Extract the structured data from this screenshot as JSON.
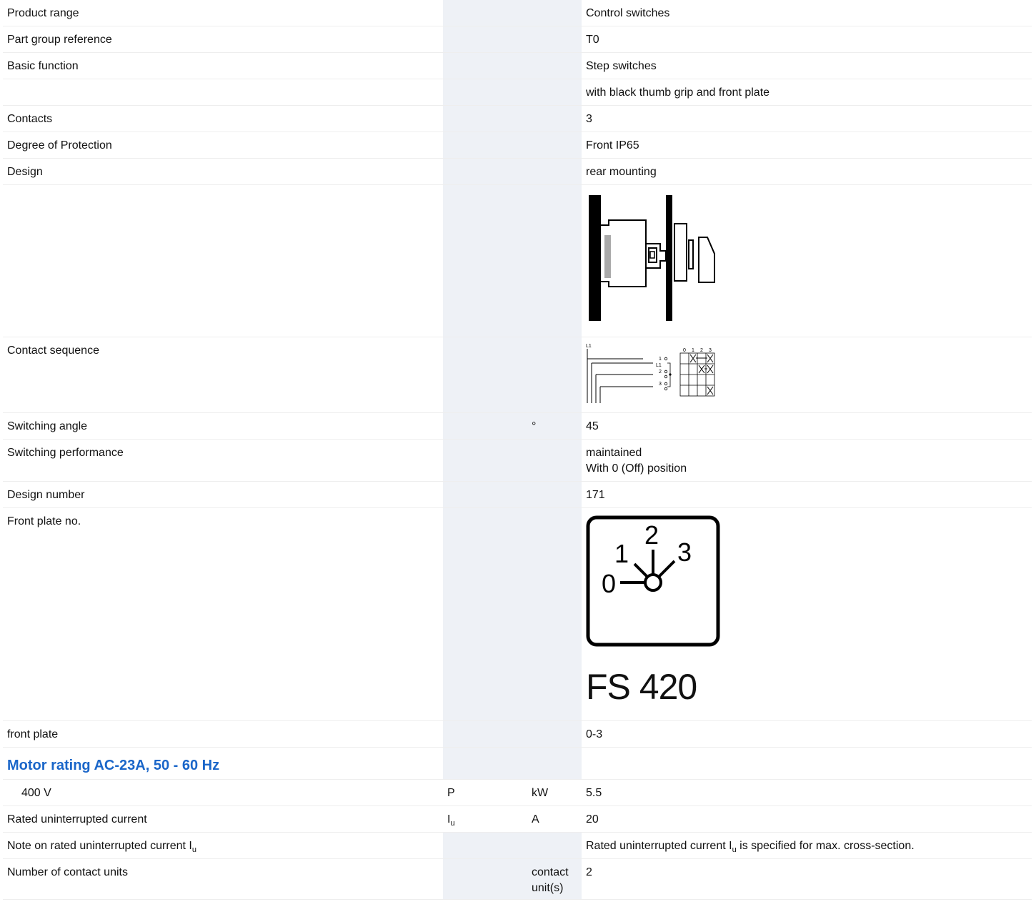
{
  "rows": [
    {
      "label": "Product range",
      "value": "Control switches"
    },
    {
      "label": "Part group reference",
      "value": "T0"
    },
    {
      "label": "Basic function",
      "value": "Step switches"
    },
    {
      "label": "",
      "value": "with black thumb grip and front plate"
    },
    {
      "label": "Contacts",
      "value": "3"
    },
    {
      "label": "Degree of Protection",
      "value": "Front IP65"
    },
    {
      "label": "Design",
      "value": "rear mounting"
    },
    {
      "label": "Contact sequence"
    },
    {
      "label": "Switching angle",
      "unit": "°",
      "value": "45"
    },
    {
      "label": "Switching performance",
      "value": "maintained",
      "value2": "With 0 (Off) position"
    },
    {
      "label": "Design number",
      "value": "171"
    },
    {
      "label": "Front plate no.",
      "figure_caption": "FS 420"
    },
    {
      "label": "front plate",
      "value": "0-3"
    },
    {
      "heading": "Motor rating AC-23A, 50 - 60 Hz"
    },
    {
      "label": "400 V",
      "symbol": "P",
      "unit": "kW",
      "value": "5.5"
    },
    {
      "label": "Rated uninterrupted current",
      "symbol": "I",
      "symbol_sub": "u",
      "unit": "A",
      "value": "20"
    },
    {
      "label": "Note on rated uninterrupted current I",
      "label_sub": "u",
      "value": "Rated uninterrupted current I",
      "value_sub": "u",
      "value_suffix": " is specified for max. cross-section."
    },
    {
      "label": "Number of contact units",
      "unit": "contact",
      "unit2": "unit(s)",
      "value": "2"
    }
  ],
  "diagrams": {
    "contact_sequence": {
      "terminal_label": "L1",
      "contacts": [
        "1",
        "L1",
        "2",
        "3"
      ],
      "positions": [
        "0",
        "1",
        "2",
        "3"
      ]
    },
    "front_plate": {
      "positions": [
        "0",
        "1",
        "2",
        "3"
      ]
    }
  }
}
